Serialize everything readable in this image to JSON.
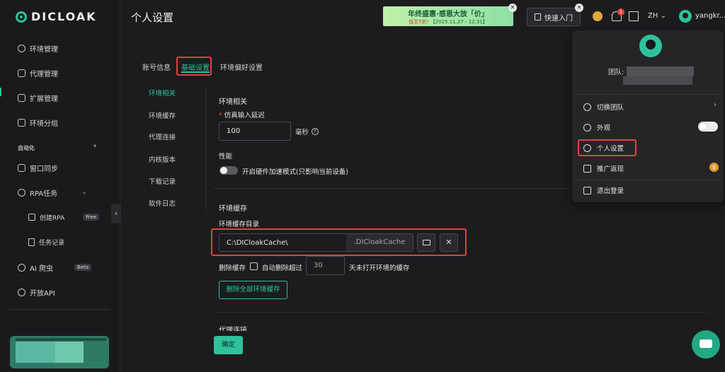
{
  "brand": {
    "logo_text": "DICLOAK",
    "accent": "#2ec29a",
    "highlight": "#e5403a"
  },
  "sidebar": {
    "items": [
      {
        "label": "环境管理",
        "icon": "globe-icon"
      },
      {
        "label": "代理管理",
        "icon": "server-icon"
      },
      {
        "label": "扩展管理",
        "icon": "puzzle-icon"
      },
      {
        "label": "环境分组",
        "icon": "folder-icon"
      }
    ],
    "automation_title": "自动化",
    "automation_items": [
      {
        "label": "窗口同步",
        "icon": "sync-icon"
      },
      {
        "label": "RPA任务",
        "icon": "robot-icon"
      }
    ],
    "rpa_sub": [
      {
        "label": "创建RPA",
        "badge": "Free",
        "icon": "shop-icon"
      },
      {
        "label": "任务记录",
        "icon": "file-icon"
      }
    ],
    "extra_items": [
      {
        "label": "AI 爬虫",
        "badge": "Beta",
        "icon": "ai-icon"
      },
      {
        "label": "开放API",
        "icon": "api-icon"
      }
    ],
    "collapse_glyph": "‹"
  },
  "header": {
    "title": "个人设置",
    "banner_line1": "年终盛惠·感恩大放「价」",
    "banner_red": "低至5折!",
    "banner_date": "【2025.11.27 - 12.31】",
    "quick_start": "快速入门",
    "notif_count": "1",
    "lang": "ZH",
    "username": "yangkr..."
  },
  "tabs": [
    "账号信息",
    "基础设置",
    "环境偏好设置"
  ],
  "left_menu": [
    "环境相关",
    "环境缓存",
    "代理连接",
    "内核版本",
    "下载记录",
    "软件日志"
  ],
  "env_section": {
    "title": "环境相关",
    "delay_label": "仿真输入延迟",
    "delay_value": "100",
    "delay_unit": "毫秒",
    "perf_label": "性能",
    "hw_toggle_label": "开启硬件加速模式(只影响当前设备)"
  },
  "cache_section": {
    "title": "环境缓存",
    "dir_label": "环境缓存目录",
    "dir_value": "C:\\DICloakCache\\",
    "dir_suffix": ".DICloakCache",
    "delete_label": "删除缓存",
    "auto_delete_label": "自动删除超过",
    "days_value": "30",
    "days_suffix": "天未打开环境的缓存",
    "delete_all_btn": "删除全部环境缓存"
  },
  "proxy_section_title": "代理连接",
  "confirm_btn": "确定",
  "dropdown": {
    "team_label": "团队:",
    "items": [
      {
        "label": "切换团队",
        "icon": "switch-team-icon"
      },
      {
        "label": "外观",
        "icon": "palette-icon"
      },
      {
        "label": "个人设置",
        "icon": "user-icon"
      },
      {
        "label": "推广返现",
        "icon": "gift-icon"
      },
      {
        "label": "退出登录",
        "icon": "logout-icon"
      }
    ]
  }
}
